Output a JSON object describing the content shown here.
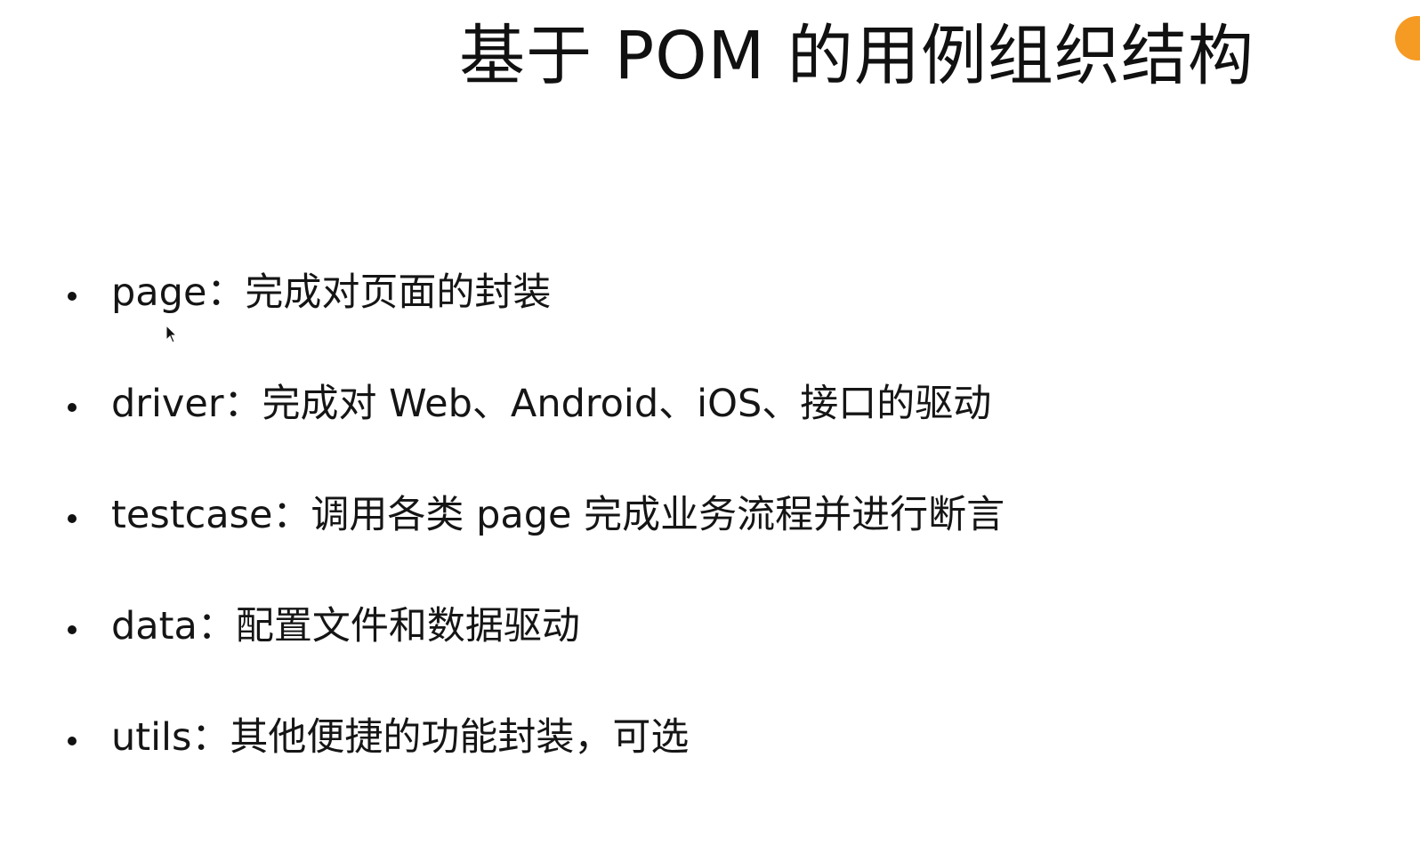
{
  "slide": {
    "title": "基于 POM 的用例组织结构",
    "bullets": [
      "page：完成对页面的封装",
      "driver：完成对 Web、Android、iOS、接口的驱动",
      "testcase：调用各类 page 完成业务流程并进行断言",
      "data：配置文件和数据驱动",
      "utils：其他便捷的功能封装，可选"
    ]
  },
  "colors": {
    "background": "#ffffff",
    "text": "#151515",
    "accent": "#f59a23"
  },
  "icons": {
    "corner": "orange-circle-icon",
    "pointer": "mouse-cursor-icon"
  }
}
